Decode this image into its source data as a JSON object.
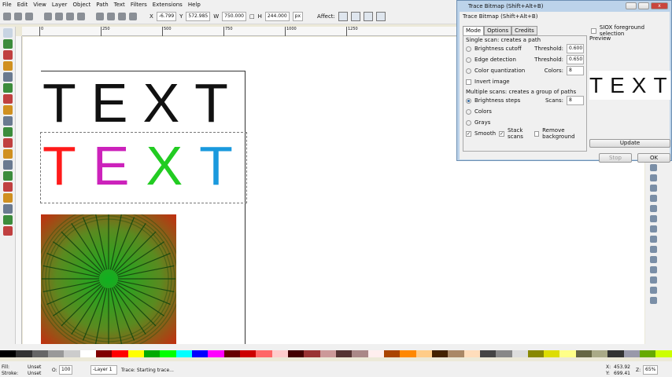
{
  "menu": [
    "File",
    "Edit",
    "View",
    "Layer",
    "Object",
    "Path",
    "Text",
    "Filters",
    "Extensions",
    "Help"
  ],
  "toolbar": {
    "x_label": "X",
    "x": "-6.799",
    "y_label": "Y",
    "y": "572.985",
    "w_label": "W",
    "w": "750.000",
    "h_label": "H",
    "h": "244.000",
    "unit": "px",
    "affect_label": "Affect:"
  },
  "ruler": [
    "0",
    "250",
    "500",
    "750",
    "1000",
    "1250"
  ],
  "canvas": {
    "text1": "TEXT",
    "text2_letters": [
      "T",
      "E",
      "X",
      "T"
    ],
    "text2_colors": [
      "#ff1a1a",
      "#cc22bb",
      "#22cc22",
      "#1a99dd"
    ]
  },
  "dialog": {
    "window_title": "Trace Bitmap (Shift+Alt+B)",
    "panel_title": "Trace Bitmap (Shift+Alt+B)",
    "tabs": [
      "Mode",
      "Options",
      "Credits"
    ],
    "single_scan_label": "Single scan: creates a path",
    "brightness_cutoff": "Brightness cutoff",
    "threshold_label": "Threshold:",
    "brightness_threshold": "0.600",
    "edge_detection": "Edge detection",
    "edge_threshold": "0.650",
    "color_quantization": "Color quantization",
    "colors_label": "Colors:",
    "colors_value": "8",
    "invert_image": "Invert image",
    "multiple_scans_label": "Multiple scans: creates a group of paths",
    "brightness_steps": "Brightness steps",
    "scans_label": "Scans:",
    "scans_value": "8",
    "colors": "Colors",
    "grays": "Grays",
    "smooth": "Smooth",
    "stack_scans": "Stack scans",
    "remove_background": "Remove background",
    "siox": "SIOX foreground selection",
    "preview_label": "Preview",
    "preview_text": "TEXT",
    "update": "Update",
    "stop": "Stop",
    "ok": "OK"
  },
  "status": {
    "fill_label": "Fill:",
    "fill": "Unset",
    "stroke_label": "Stroke:",
    "stroke": "Unset",
    "opacity_label": "O:",
    "opacity": "100",
    "layer": "-Layer 1",
    "message": "Trace: Starting trace...",
    "x_label": "X:",
    "x": "453.92",
    "y_label": "Y:",
    "y": "699.41",
    "zoom_label": "Z:",
    "zoom": "65%"
  }
}
